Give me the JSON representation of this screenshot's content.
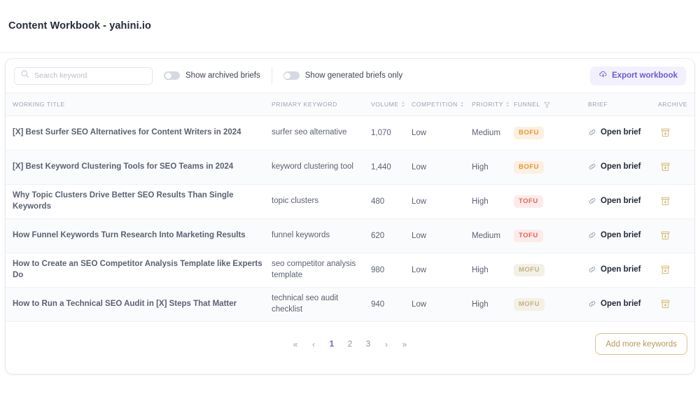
{
  "header": {
    "title": "Content Workbook - yahini.io"
  },
  "toolbar": {
    "search": {
      "placeholder": "Search keyword",
      "value": "",
      "icon": "search-icon"
    },
    "toggles": [
      {
        "label": "Show archived briefs",
        "on": false
      },
      {
        "label": "Show generated briefs only",
        "on": false
      }
    ],
    "export_button": {
      "label": "Export workbook",
      "icon": "cloud-download-icon",
      "color": "#6d5bd0",
      "background": "#f3f0fe"
    }
  },
  "table": {
    "columns": [
      {
        "key": "title",
        "label": "WORKING TITLE",
        "sortable": false,
        "filter": false
      },
      {
        "key": "keyword",
        "label": "PRIMARY KEYWORD",
        "sortable": false,
        "filter": false
      },
      {
        "key": "volume",
        "label": "VOLUME",
        "sortable": true,
        "filter": false
      },
      {
        "key": "comp",
        "label": "COMPETITION",
        "sortable": true,
        "filter": false
      },
      {
        "key": "prio",
        "label": "PRIORITY",
        "sortable": true,
        "filter": false
      },
      {
        "key": "funnel",
        "label": "FUNNEL",
        "sortable": false,
        "filter": true
      },
      {
        "key": "brief",
        "label": "BRIEF",
        "sortable": false,
        "filter": false
      },
      {
        "key": "archive",
        "label": "ARCHIVE",
        "sortable": false,
        "filter": false
      }
    ],
    "brief_link_label": "Open brief",
    "brief_link_icon": "link-icon",
    "archive_icon": "archive-box-icon",
    "rows": [
      {
        "title": "[X] Best Surfer SEO Alternatives for Content Writers in 2024",
        "keyword": "surfer seo alternative",
        "volume": "1,070",
        "comp": "Low",
        "prio": "Medium",
        "funnel": "BOFU"
      },
      {
        "title": "[X] Best Keyword Clustering Tools for SEO Teams in 2024",
        "keyword": "keyword clustering tool",
        "volume": "1,440",
        "comp": "Low",
        "prio": "High",
        "funnel": "BOFU"
      },
      {
        "title": "Why Topic Clusters Drive Better SEO Results Than Single Keywords",
        "keyword": "topic clusters",
        "volume": "480",
        "comp": "Low",
        "prio": "High",
        "funnel": "TOFU"
      },
      {
        "title": "How Funnel Keywords Turn Research Into Marketing Results",
        "keyword": "funnel keywords",
        "volume": "620",
        "comp": "Low",
        "prio": "Medium",
        "funnel": "TOFU"
      },
      {
        "title": "How to Create an SEO Competitor Analysis Template like Experts Do",
        "keyword": "seo competitor analysis template",
        "volume": "980",
        "comp": "Low",
        "prio": "High",
        "funnel": "MOFU"
      },
      {
        "title": "How to Run a Technical SEO Audit in [X] Steps That Matter",
        "keyword": "technical seo audit checklist",
        "volume": "940",
        "comp": "Low",
        "prio": "High",
        "funnel": "MOFU"
      }
    ]
  },
  "footer": {
    "pagination": {
      "first_label": "«",
      "prev_label": "‹",
      "pages": [
        "1",
        "2",
        "3"
      ],
      "current_page": "1",
      "next_label": "›",
      "last_label": "»"
    },
    "add_keywords_button": {
      "label": "Add more keywords",
      "color": "#b59a55",
      "border_color": "#dbc48c"
    }
  }
}
